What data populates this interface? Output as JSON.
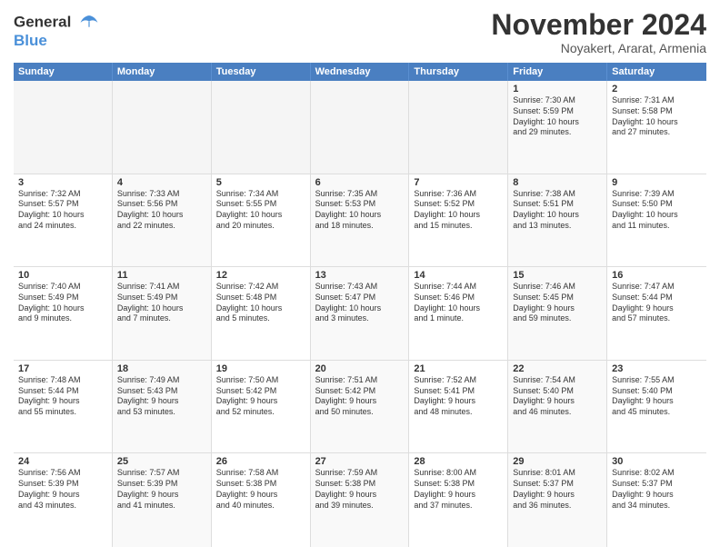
{
  "header": {
    "logo_line1": "General",
    "logo_line2": "Blue",
    "month": "November 2024",
    "location": "Noyakert, Ararat, Armenia"
  },
  "weekdays": [
    "Sunday",
    "Monday",
    "Tuesday",
    "Wednesday",
    "Thursday",
    "Friday",
    "Saturday"
  ],
  "rows": [
    [
      {
        "day": "",
        "lines": [],
        "empty": true
      },
      {
        "day": "",
        "lines": [],
        "empty": true
      },
      {
        "day": "",
        "lines": [],
        "empty": true
      },
      {
        "day": "",
        "lines": [],
        "empty": true
      },
      {
        "day": "",
        "lines": [],
        "empty": true
      },
      {
        "day": "1",
        "lines": [
          "Sunrise: 7:30 AM",
          "Sunset: 5:59 PM",
          "Daylight: 10 hours",
          "and 29 minutes."
        ],
        "empty": false
      },
      {
        "day": "2",
        "lines": [
          "Sunrise: 7:31 AM",
          "Sunset: 5:58 PM",
          "Daylight: 10 hours",
          "and 27 minutes."
        ],
        "empty": false
      }
    ],
    [
      {
        "day": "3",
        "lines": [
          "Sunrise: 7:32 AM",
          "Sunset: 5:57 PM",
          "Daylight: 10 hours",
          "and 24 minutes."
        ],
        "empty": false
      },
      {
        "day": "4",
        "lines": [
          "Sunrise: 7:33 AM",
          "Sunset: 5:56 PM",
          "Daylight: 10 hours",
          "and 22 minutes."
        ],
        "empty": false
      },
      {
        "day": "5",
        "lines": [
          "Sunrise: 7:34 AM",
          "Sunset: 5:55 PM",
          "Daylight: 10 hours",
          "and 20 minutes."
        ],
        "empty": false
      },
      {
        "day": "6",
        "lines": [
          "Sunrise: 7:35 AM",
          "Sunset: 5:53 PM",
          "Daylight: 10 hours",
          "and 18 minutes."
        ],
        "empty": false
      },
      {
        "day": "7",
        "lines": [
          "Sunrise: 7:36 AM",
          "Sunset: 5:52 PM",
          "Daylight: 10 hours",
          "and 15 minutes."
        ],
        "empty": false
      },
      {
        "day": "8",
        "lines": [
          "Sunrise: 7:38 AM",
          "Sunset: 5:51 PM",
          "Daylight: 10 hours",
          "and 13 minutes."
        ],
        "empty": false
      },
      {
        "day": "9",
        "lines": [
          "Sunrise: 7:39 AM",
          "Sunset: 5:50 PM",
          "Daylight: 10 hours",
          "and 11 minutes."
        ],
        "empty": false
      }
    ],
    [
      {
        "day": "10",
        "lines": [
          "Sunrise: 7:40 AM",
          "Sunset: 5:49 PM",
          "Daylight: 10 hours",
          "and 9 minutes."
        ],
        "empty": false
      },
      {
        "day": "11",
        "lines": [
          "Sunrise: 7:41 AM",
          "Sunset: 5:49 PM",
          "Daylight: 10 hours",
          "and 7 minutes."
        ],
        "empty": false
      },
      {
        "day": "12",
        "lines": [
          "Sunrise: 7:42 AM",
          "Sunset: 5:48 PM",
          "Daylight: 10 hours",
          "and 5 minutes."
        ],
        "empty": false
      },
      {
        "day": "13",
        "lines": [
          "Sunrise: 7:43 AM",
          "Sunset: 5:47 PM",
          "Daylight: 10 hours",
          "and 3 minutes."
        ],
        "empty": false
      },
      {
        "day": "14",
        "lines": [
          "Sunrise: 7:44 AM",
          "Sunset: 5:46 PM",
          "Daylight: 10 hours",
          "and 1 minute."
        ],
        "empty": false
      },
      {
        "day": "15",
        "lines": [
          "Sunrise: 7:46 AM",
          "Sunset: 5:45 PM",
          "Daylight: 9 hours",
          "and 59 minutes."
        ],
        "empty": false
      },
      {
        "day": "16",
        "lines": [
          "Sunrise: 7:47 AM",
          "Sunset: 5:44 PM",
          "Daylight: 9 hours",
          "and 57 minutes."
        ],
        "empty": false
      }
    ],
    [
      {
        "day": "17",
        "lines": [
          "Sunrise: 7:48 AM",
          "Sunset: 5:44 PM",
          "Daylight: 9 hours",
          "and 55 minutes."
        ],
        "empty": false
      },
      {
        "day": "18",
        "lines": [
          "Sunrise: 7:49 AM",
          "Sunset: 5:43 PM",
          "Daylight: 9 hours",
          "and 53 minutes."
        ],
        "empty": false
      },
      {
        "day": "19",
        "lines": [
          "Sunrise: 7:50 AM",
          "Sunset: 5:42 PM",
          "Daylight: 9 hours",
          "and 52 minutes."
        ],
        "empty": false
      },
      {
        "day": "20",
        "lines": [
          "Sunrise: 7:51 AM",
          "Sunset: 5:42 PM",
          "Daylight: 9 hours",
          "and 50 minutes."
        ],
        "empty": false
      },
      {
        "day": "21",
        "lines": [
          "Sunrise: 7:52 AM",
          "Sunset: 5:41 PM",
          "Daylight: 9 hours",
          "and 48 minutes."
        ],
        "empty": false
      },
      {
        "day": "22",
        "lines": [
          "Sunrise: 7:54 AM",
          "Sunset: 5:40 PM",
          "Daylight: 9 hours",
          "and 46 minutes."
        ],
        "empty": false
      },
      {
        "day": "23",
        "lines": [
          "Sunrise: 7:55 AM",
          "Sunset: 5:40 PM",
          "Daylight: 9 hours",
          "and 45 minutes."
        ],
        "empty": false
      }
    ],
    [
      {
        "day": "24",
        "lines": [
          "Sunrise: 7:56 AM",
          "Sunset: 5:39 PM",
          "Daylight: 9 hours",
          "and 43 minutes."
        ],
        "empty": false
      },
      {
        "day": "25",
        "lines": [
          "Sunrise: 7:57 AM",
          "Sunset: 5:39 PM",
          "Daylight: 9 hours",
          "and 41 minutes."
        ],
        "empty": false
      },
      {
        "day": "26",
        "lines": [
          "Sunrise: 7:58 AM",
          "Sunset: 5:38 PM",
          "Daylight: 9 hours",
          "and 40 minutes."
        ],
        "empty": false
      },
      {
        "day": "27",
        "lines": [
          "Sunrise: 7:59 AM",
          "Sunset: 5:38 PM",
          "Daylight: 9 hours",
          "and 39 minutes."
        ],
        "empty": false
      },
      {
        "day": "28",
        "lines": [
          "Sunrise: 8:00 AM",
          "Sunset: 5:38 PM",
          "Daylight: 9 hours",
          "and 37 minutes."
        ],
        "empty": false
      },
      {
        "day": "29",
        "lines": [
          "Sunrise: 8:01 AM",
          "Sunset: 5:37 PM",
          "Daylight: 9 hours",
          "and 36 minutes."
        ],
        "empty": false
      },
      {
        "day": "30",
        "lines": [
          "Sunrise: 8:02 AM",
          "Sunset: 5:37 PM",
          "Daylight: 9 hours",
          "and 34 minutes."
        ],
        "empty": false
      }
    ]
  ]
}
